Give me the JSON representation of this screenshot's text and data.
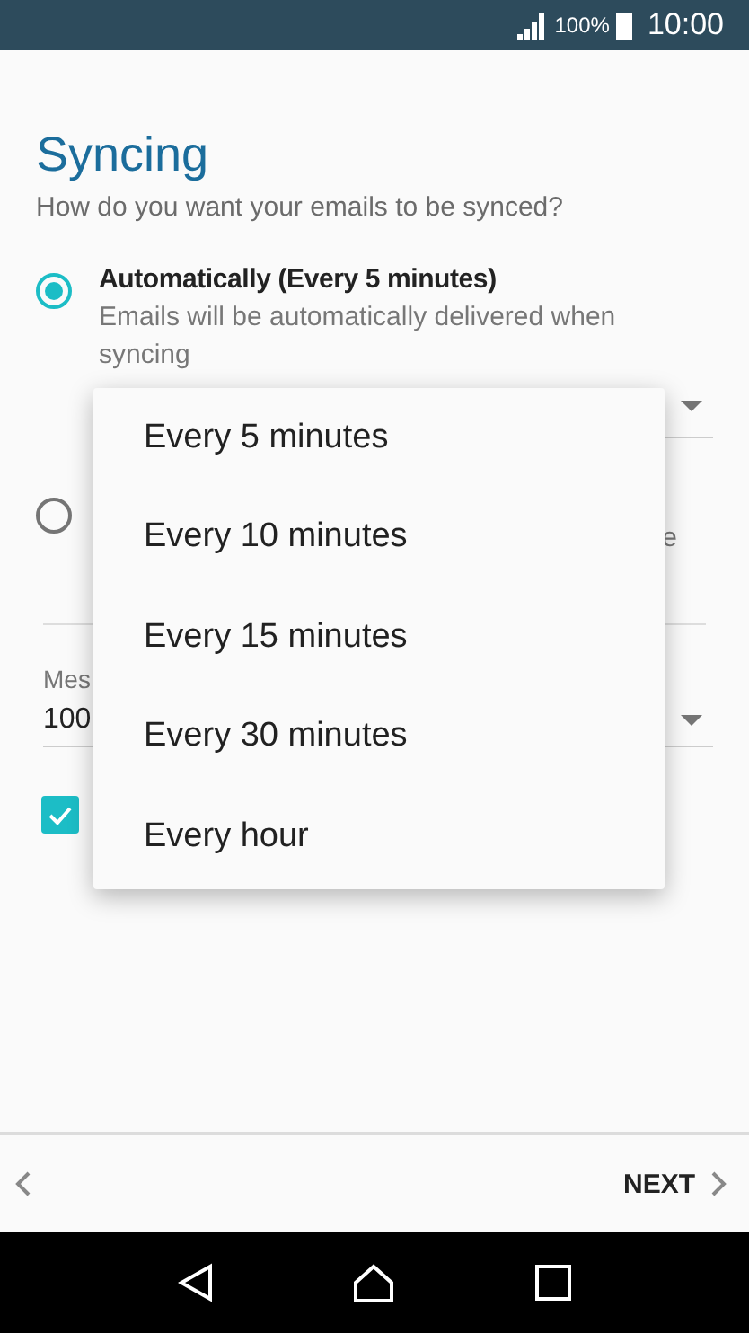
{
  "status_bar": {
    "battery": "100%",
    "time": "10:00"
  },
  "title": "Syncing",
  "subtitle": "How do you want your emails to be synced?",
  "sync_options": [
    {
      "label": "Automatically (Every 5 minutes)",
      "description": "Emails will be automatically delivered when syncing",
      "selected": true
    },
    {
      "fragment": "e",
      "selected": false
    }
  ],
  "message_field": {
    "label": "Mes",
    "value": "100"
  },
  "checkbox": {
    "checked": true
  },
  "menu": {
    "items": [
      "Every 5 minutes",
      "Every 10 minutes",
      "Every 15 minutes",
      "Every 30 minutes",
      "Every hour"
    ]
  },
  "footer": {
    "next": "NEXT"
  }
}
